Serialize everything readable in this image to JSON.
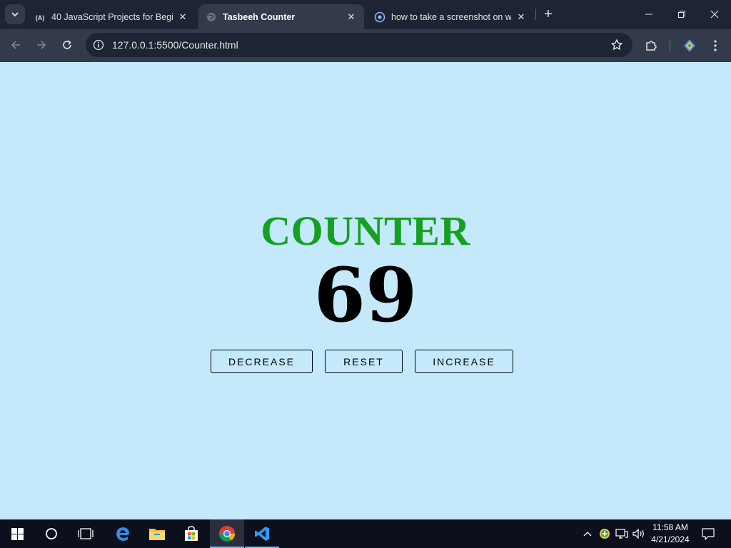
{
  "browser": {
    "tabs": [
      {
        "title": "40 JavaScript Projects for Begi",
        "icon": "angular-icon",
        "active": false
      },
      {
        "title": "Tasbeeh Counter",
        "icon": "globe-icon",
        "active": true
      },
      {
        "title": "how to take a screenshot on w",
        "icon": "chrome-search-icon",
        "active": false
      }
    ],
    "url": "127.0.0.1:5500/Counter.html"
  },
  "page": {
    "title": "COUNTER",
    "count": "69",
    "buttons": {
      "decrease": "DECREASE",
      "reset": "RESET",
      "increase": "INCREASE"
    }
  },
  "colors": {
    "page_background": "#c3e9fb",
    "title_color": "#16a021",
    "chrome_dark": "#1e2433",
    "chrome_light": "#323a4c"
  },
  "taskbar": {
    "time": "11:58 AM",
    "date": "4/21/2024"
  }
}
